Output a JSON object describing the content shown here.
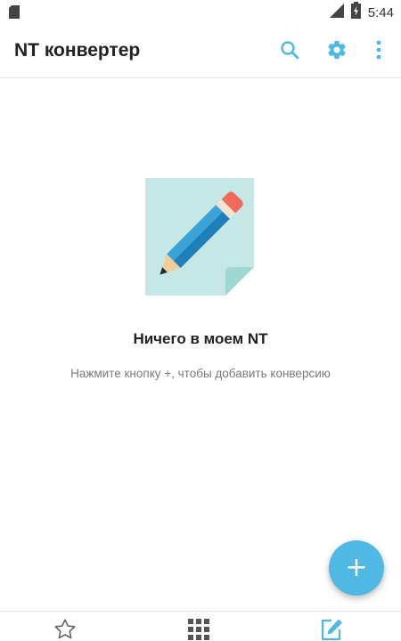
{
  "status_bar": {
    "time": "5:44",
    "icons": [
      "sd-card-icon",
      "signal-icon",
      "battery-icon"
    ]
  },
  "app_bar": {
    "title": "NT конвертер",
    "icons": [
      "search-icon",
      "gear-icon",
      "more-vert-icon"
    ],
    "accent_color": "#4fb8e3"
  },
  "empty_state": {
    "illustration": "pencil-note-icon",
    "title": "Ничего в моем NT",
    "hint": "Нажмите кнопку +, чтобы добавить конверсию"
  },
  "fab": {
    "label": "+",
    "color": "#4fb8e3"
  },
  "bottom_nav": {
    "items": [
      {
        "icon": "star-outline-icon"
      },
      {
        "icon": "grid-icon"
      },
      {
        "icon": "edit-icon",
        "active": true
      }
    ]
  }
}
